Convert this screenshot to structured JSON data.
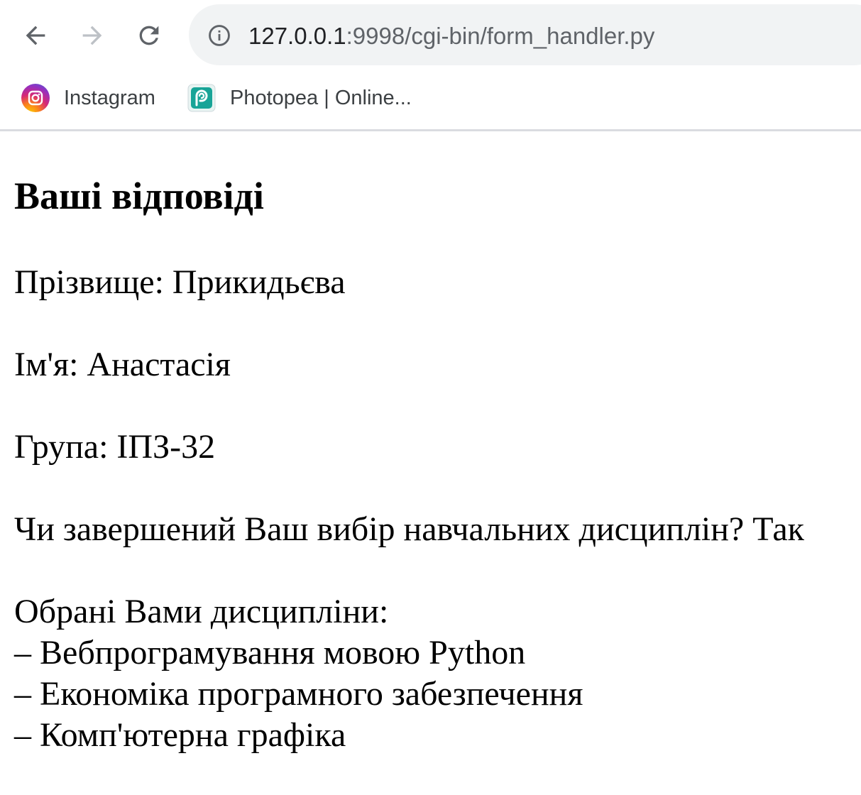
{
  "browser": {
    "url_host": "127.0.0.1",
    "url_path": ":9998/cgi-bin/form_handler.py",
    "bookmarks": [
      {
        "label": "Instagram",
        "icon": "instagram-icon"
      },
      {
        "label": "Photopea | Online...",
        "icon": "photopea-icon"
      }
    ]
  },
  "page": {
    "heading": "Ваші відповіді",
    "surname": "Прізвище: Прикидьєва",
    "name": "Ім'я: Анастасія",
    "group": "Група: ІПЗ-32",
    "completed": "Чи завершений Ваш вибір навчальних дисциплін? Так",
    "disciplines_title": "Обрані Вами дисципліни:",
    "disciplines": [
      "– Вебпрограмування мовою Python",
      "– Економіка програмного забезпечення",
      "– Комп'ютерна графіка"
    ]
  },
  "colors": {
    "omnibox_bg": "#f1f3f4",
    "url_host": "#202124",
    "url_path": "#5f6368",
    "photopea_brand": "#18a497"
  }
}
